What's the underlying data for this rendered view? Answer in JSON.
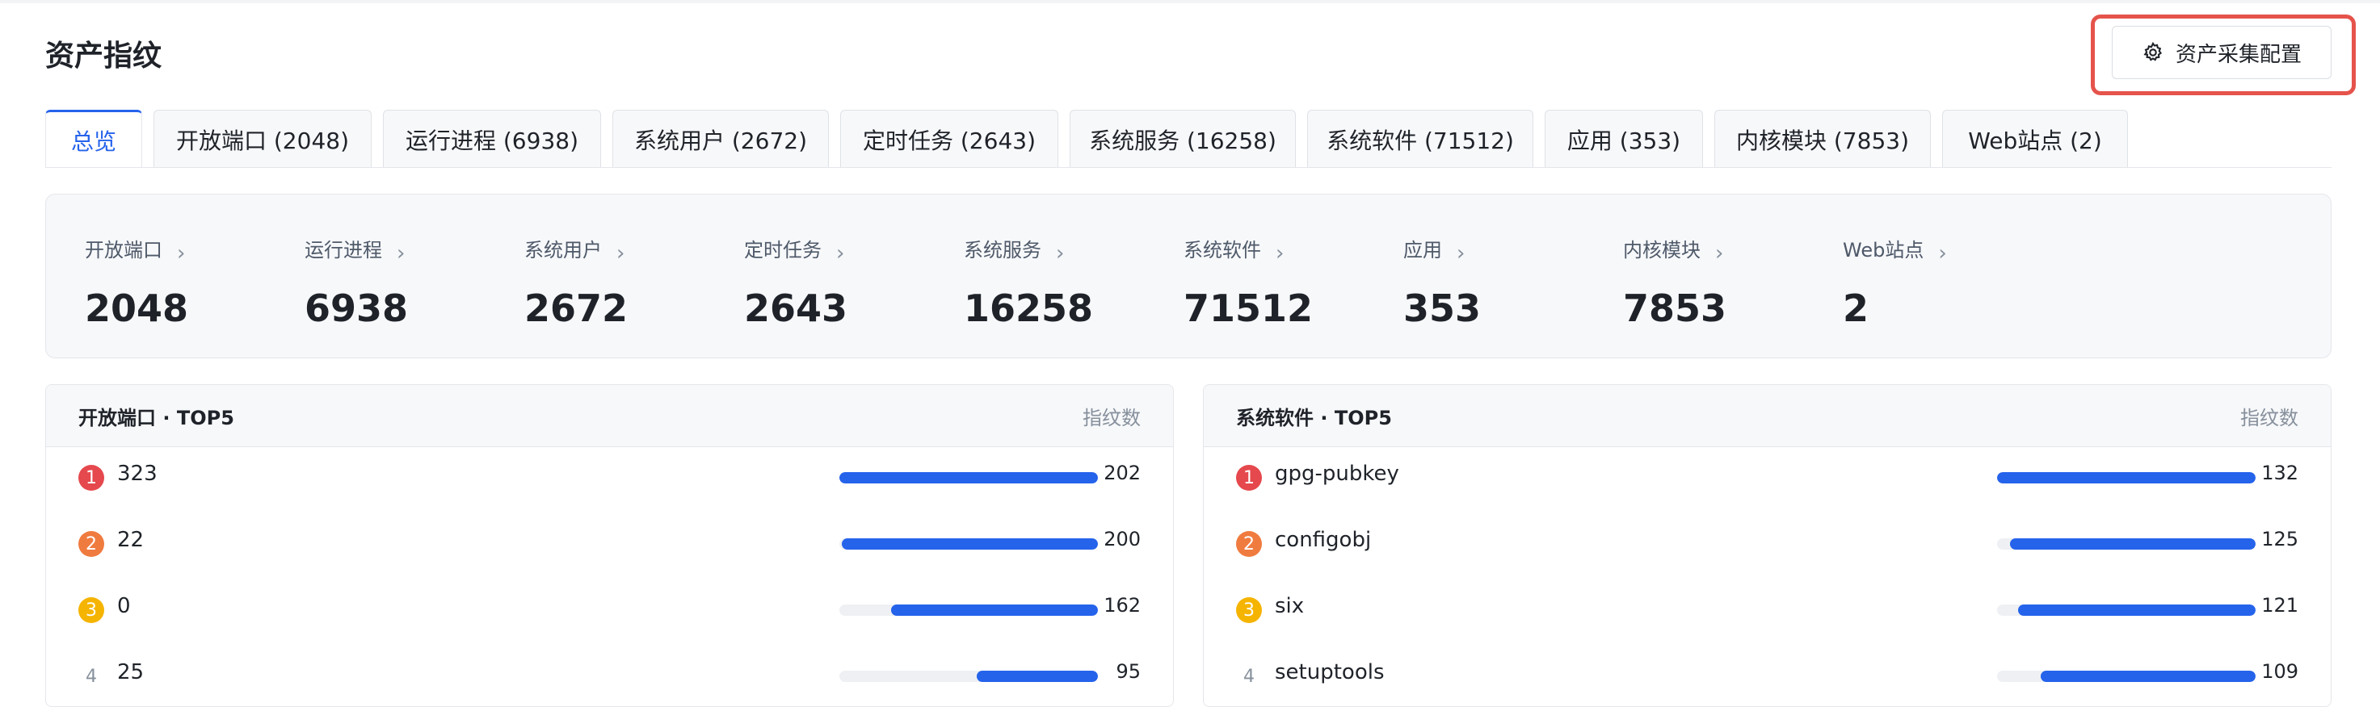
{
  "header": {
    "title": "资产指纹",
    "config_button": "资产采集配置"
  },
  "tabs": [
    {
      "label": "总览",
      "active": true
    },
    {
      "label": "开放端口 (2048)"
    },
    {
      "label": "运行进程 (6938)"
    },
    {
      "label": "系统用户 (2672)"
    },
    {
      "label": "定时任务 (2643)"
    },
    {
      "label": "系统服务 (16258)"
    },
    {
      "label": "系统软件 (71512)"
    },
    {
      "label": "应用 (353)"
    },
    {
      "label": "内核模块 (7853)"
    },
    {
      "label": "Web站点 (2)"
    }
  ],
  "summary": [
    {
      "label": "开放端口",
      "value": "2048"
    },
    {
      "label": "运行进程",
      "value": "6938"
    },
    {
      "label": "系统用户",
      "value": "2672"
    },
    {
      "label": "定时任务",
      "value": "2643"
    },
    {
      "label": "系统服务",
      "value": "16258"
    },
    {
      "label": "系统软件",
      "value": "71512"
    },
    {
      "label": "应用",
      "value": "353"
    },
    {
      "label": "内核模块",
      "value": "7853"
    },
    {
      "label": "Web站点",
      "value": "2"
    }
  ],
  "panels": [
    {
      "title": "开放端口 · TOP5",
      "metric": "指纹数",
      "rows": [
        {
          "rank": "1",
          "name": "323",
          "value": "202",
          "fill": 1.0
        },
        {
          "rank": "2",
          "name": "22",
          "value": "200",
          "fill": 0.99
        },
        {
          "rank": "3",
          "name": "0",
          "value": "162",
          "fill": 0.8
        },
        {
          "rank": "4",
          "name": "25",
          "value": "95",
          "fill": 0.47
        }
      ]
    },
    {
      "title": "系统软件 · TOP5",
      "metric": "指纹数",
      "rows": [
        {
          "rank": "1",
          "name": "gpg-pubkey",
          "value": "132",
          "fill": 1.0
        },
        {
          "rank": "2",
          "name": "configobj",
          "value": "125",
          "fill": 0.95
        },
        {
          "rank": "3",
          "name": "six",
          "value": "121",
          "fill": 0.92
        },
        {
          "rank": "4",
          "name": "setuptools",
          "value": "109",
          "fill": 0.83
        }
      ]
    }
  ],
  "colors": {
    "accent": "#2563eb",
    "rank1": "#e5484d",
    "rank2": "#f07b3f",
    "rank3": "#f5b400",
    "highlight": "#e5534b"
  }
}
